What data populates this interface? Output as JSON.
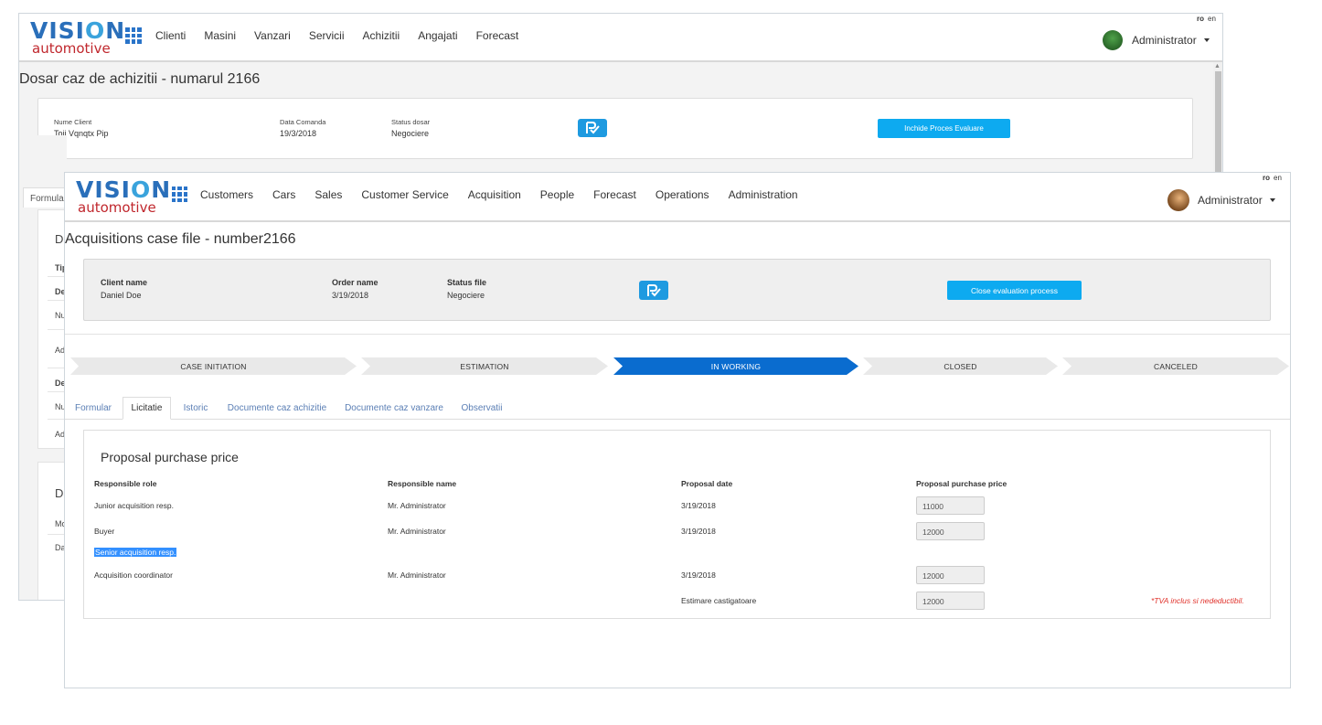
{
  "brand": {
    "word1_pre": "VISI",
    "word1_o": "O",
    "word1_post": "N",
    "word2": "automotive"
  },
  "back_window": {
    "nav": [
      "Clienti",
      "Masini",
      "Vanzari",
      "Servicii",
      "Achizitii",
      "Angajati",
      "Forecast"
    ],
    "lang": {
      "active": "ro",
      "other": "en"
    },
    "user": "Administrator",
    "title": "Dosar caz de achizitii - numarul 2166",
    "info": {
      "client_label": "Nume Client",
      "client_value": "Toij Vqnqtx Pip",
      "date_label": "Data Comanda",
      "date_value": "19/3/2018",
      "status_label": "Status dosar",
      "status_value": "Negociere",
      "close_button": "Inchide Proces Evaluare"
    },
    "partial": {
      "tab": "Formular",
      "panel1": [
        "Da",
        "Tip",
        "De",
        "Nu",
        "Ad",
        "De",
        "Nu",
        "Ad"
      ],
      "panel2": [
        "Da",
        "Mo",
        "Da"
      ]
    }
  },
  "front_window": {
    "nav": [
      "Customers",
      "Cars",
      "Sales",
      "Customer Service",
      "Acquisition",
      "People",
      "Forecast",
      "Operations",
      "Administration"
    ],
    "lang": {
      "active": "ro",
      "other": "en"
    },
    "user": "Administrator",
    "title": "Acquisitions case file - number2166",
    "info": {
      "client_label": "Client name",
      "client_value": "Daniel Doe",
      "order_label": "Order name",
      "order_value": "3/19/2018",
      "status_label": "Status file",
      "status_value": "Negociere",
      "close_button": "Close evaluation process"
    },
    "steps": [
      {
        "label": "CASE INITIATION",
        "active": false
      },
      {
        "label": "ESTIMATION",
        "active": false
      },
      {
        "label": "IN WORKING",
        "active": true
      },
      {
        "label": "CLOSED",
        "active": false
      },
      {
        "label": "CANCELED",
        "active": false
      }
    ],
    "tabs": [
      {
        "label": "Formular",
        "active": false
      },
      {
        "label": "Licitatie",
        "active": true
      },
      {
        "label": "Istoric",
        "active": false
      },
      {
        "label": "Documente caz achizitie",
        "active": false
      },
      {
        "label": "Documente caz vanzare",
        "active": false
      },
      {
        "label": "Observatii",
        "active": false
      }
    ],
    "proposal": {
      "title": "Proposal purchase price",
      "headers": [
        "Responsible role",
        "Responsible name",
        "Proposal date",
        "Proposal purchase price"
      ],
      "rows": [
        {
          "role": "Junior acquisition resp.",
          "name": "Mr. Administrator",
          "date": "3/19/2018",
          "price": "11000"
        },
        {
          "role": "Buyer",
          "name": "Mr. Administrator",
          "date": "3/19/2018",
          "price": "12000"
        },
        {
          "role": "Senior acquisition resp.",
          "name": "",
          "date": "",
          "price": ""
        },
        {
          "role": "Acquisition coordinator",
          "name": "Mr. Administrator",
          "date": "3/19/2018",
          "price": "12000"
        }
      ],
      "estimate_label": "Estimare castigatoare",
      "estimate_value": "12000",
      "note": "*TVA inclus si nedeductibil."
    }
  },
  "colors": {
    "brand_blue": "#2a6fba",
    "brand_red": "#c0272d",
    "accent": "#0daaf0",
    "step_active": "#0a6ccf",
    "step_inactive": "#e9e9e9"
  }
}
